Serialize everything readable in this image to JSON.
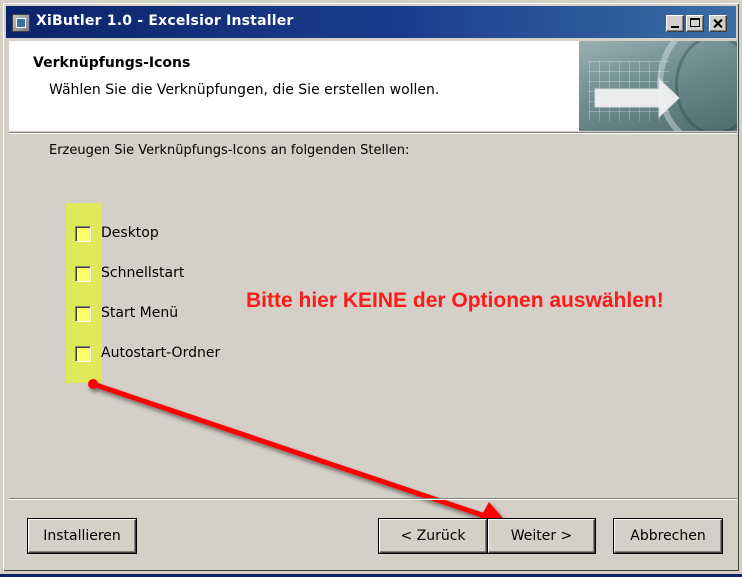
{
  "window": {
    "title": "XiButler 1.0 - Excelsior Installer",
    "controls": {
      "minimize": "minimize",
      "maximize": "maximize",
      "close": "close"
    }
  },
  "banner": {
    "title": "Verknüpfungs-Icons",
    "subtitle": "Wählen Sie die Verknüpfungen, die Sie erstellen wollen."
  },
  "instruction": "Erzeugen Sie Verknüpfungs-Icons an folgenden Stellen:",
  "checkboxes": [
    {
      "label": "Desktop",
      "checked": false
    },
    {
      "label": "Schnellstart",
      "checked": false
    },
    {
      "label": "Start Menü",
      "checked": false
    },
    {
      "label": "Autostart-Ordner",
      "checked": false
    }
  ],
  "annotation": {
    "warning_text": "Bitte hier KEINE der Optionen auswählen!",
    "warning_color": "#ff1a1a",
    "highlight_color": "#e2ea4d",
    "arrow_color": "#ff0000"
  },
  "buttons": {
    "install": "Installieren",
    "back": "< Zurück",
    "next": "Weiter >",
    "cancel": "Abbrechen"
  },
  "colors": {
    "titlebar_start": "#0a246a",
    "titlebar_end": "#3a6ea5",
    "window_bg": "#d4d0c8"
  }
}
